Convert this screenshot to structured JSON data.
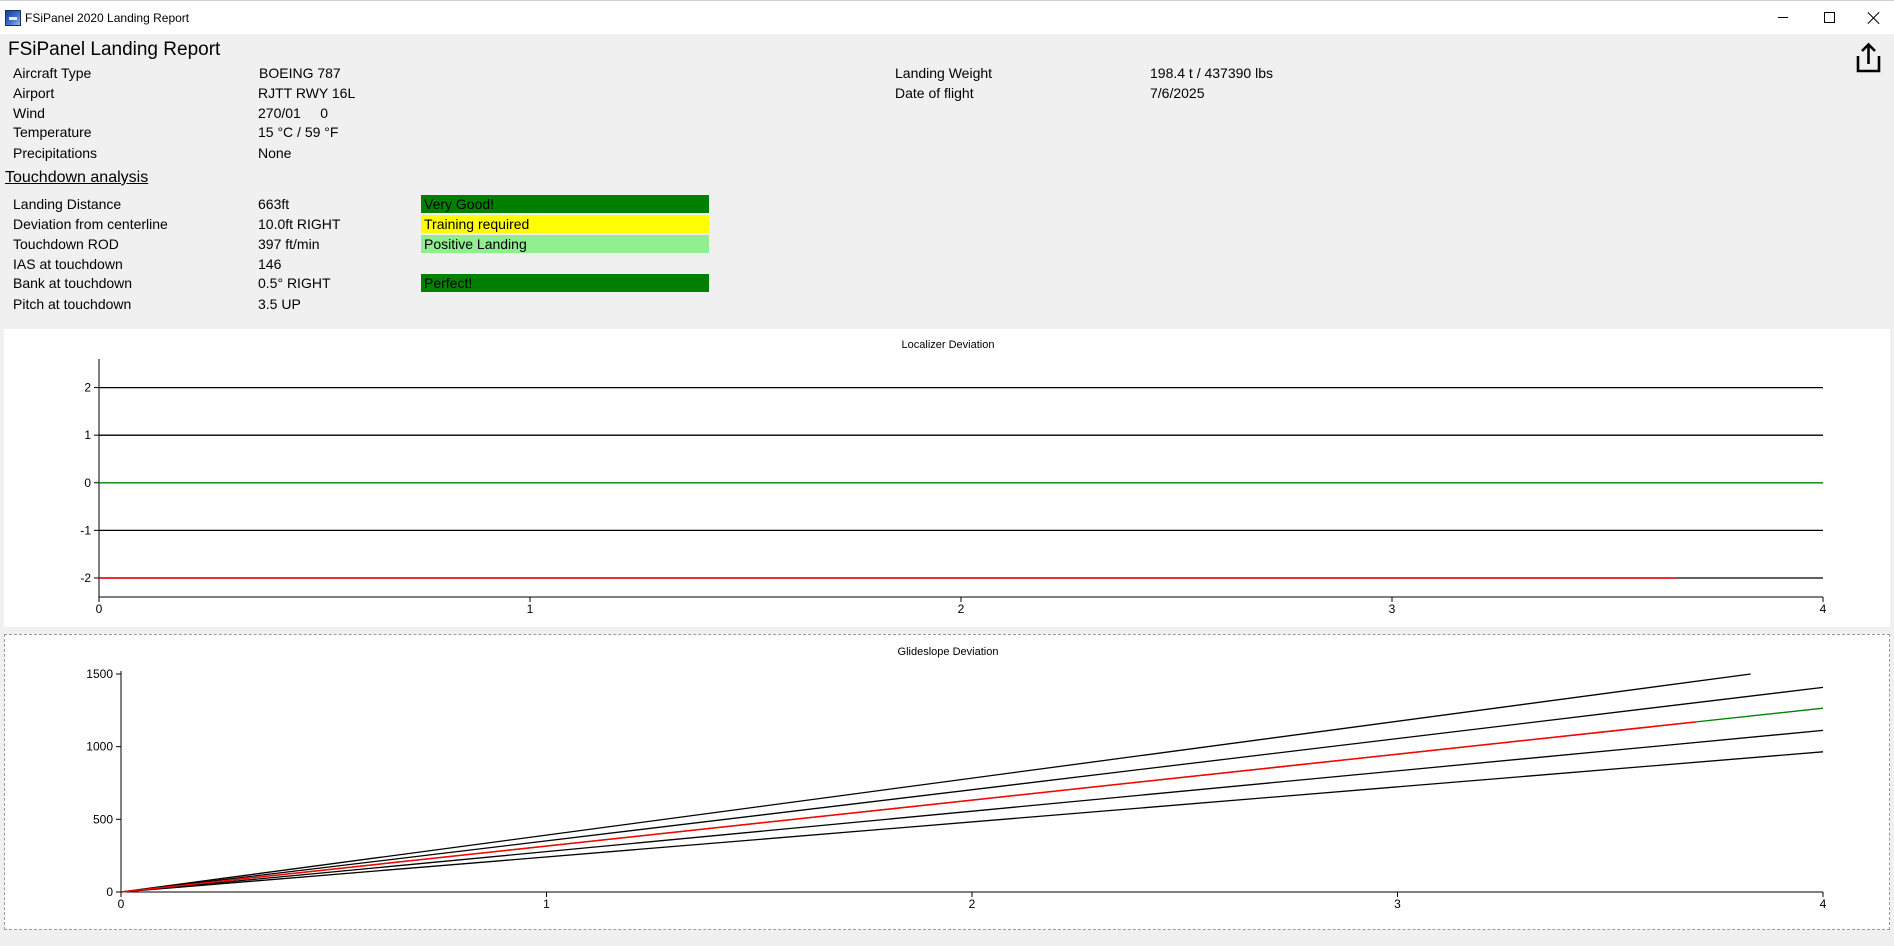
{
  "window": {
    "title": "FSiPanel 2020 Landing Report",
    "icon": "fsipanel-app-icon",
    "controls": [
      "minimize-icon",
      "maximize-icon",
      "close-icon"
    ]
  },
  "report": {
    "title": "FSiPanel Landing Report",
    "share_icon": "share-export-icon",
    "info": {
      "aircraft_type": {
        "label": "Aircraft Type",
        "value": "BOEING 787"
      },
      "airport": {
        "label": "Airport",
        "value": "RJTT RWY 16L"
      },
      "wind": {
        "label": "Wind",
        "value": "270/01     0"
      },
      "temperature": {
        "label": "Temperature",
        "value": "15 °C / 59 °F"
      },
      "precipitations": {
        "label": "Precipitations",
        "value": "None"
      },
      "landing_weight": {
        "label": "Landing Weight",
        "value": "198.4 t / 437390 lbs"
      },
      "date_of_flight": {
        "label": "Date of flight",
        "value": "7/6/2025"
      }
    },
    "touchdown": {
      "title": "Touchdown analysis",
      "rows": [
        {
          "label": "Landing Distance",
          "value": "663ft",
          "rating": "Very Good!",
          "rating_color": "#008000"
        },
        {
          "label": "Deviation from centerline",
          "value": "10.0ft RIGHT",
          "rating": "Training required",
          "rating_color": "#ffff00"
        },
        {
          "label": "Touchdown ROD",
          "value": "397 ft/min",
          "rating": "Positive Landing",
          "rating_color": "#90ee90"
        },
        {
          "label": "IAS at touchdown",
          "value": "146",
          "rating": "",
          "rating_color": ""
        },
        {
          "label": "Bank at touchdown",
          "value": "0.5° RIGHT",
          "rating": "Perfect!",
          "rating_color": "#008000"
        },
        {
          "label": "Pitch at touchdown",
          "value": "3.5 UP",
          "rating": "",
          "rating_color": ""
        }
      ]
    }
  },
  "chart_data": [
    {
      "type": "line",
      "title": "Localizer Deviation",
      "xlabel": "",
      "ylabel": "",
      "xlim": [
        0,
        4
      ],
      "ylim": [
        -2.4,
        2.6
      ],
      "x_ticks": [
        "0",
        "1",
        "2",
        "3",
        "4"
      ],
      "y_ticks": [
        "2",
        "1",
        "0",
        "-1",
        "-2"
      ],
      "series": [
        {
          "color": "#000000",
          "points": [
            [
              0,
              2
            ],
            [
              4,
              2
            ]
          ]
        },
        {
          "color": "#000000",
          "points": [
            [
              0,
              1
            ],
            [
              4,
              1
            ]
          ]
        },
        {
          "color": "#000000",
          "points": [
            [
              0,
              -1
            ],
            [
              4,
              -1
            ]
          ]
        },
        {
          "color": "#000000",
          "points": [
            [
              0,
              -2
            ],
            [
              4,
              -2
            ]
          ]
        },
        {
          "color": "#008000",
          "points": [
            [
              0,
              0
            ],
            [
              4,
              0
            ]
          ]
        },
        {
          "color": "#ff0000",
          "points": [
            [
              0,
              -2
            ],
            [
              3.66,
              -2
            ]
          ]
        }
      ]
    },
    {
      "type": "line",
      "title": "Glideslope Deviation",
      "xlabel": "",
      "ylabel": "",
      "xlim": [
        0,
        4
      ],
      "ylim": [
        0,
        1500
      ],
      "x_ticks": [
        "0",
        "1",
        "2",
        "3",
        "4"
      ],
      "y_ticks": [
        "1500",
        "1000",
        "500",
        "0"
      ],
      "series": [
        {
          "color": "#000000",
          "points": [
            [
              0,
              0
            ],
            [
              3.83,
              1500
            ]
          ]
        },
        {
          "color": "#000000",
          "points": [
            [
              0,
              0
            ],
            [
              4,
              1408
            ]
          ]
        },
        {
          "color": "#000000",
          "points": [
            [
              0,
              0
            ],
            [
              4,
              1112
            ]
          ]
        },
        {
          "color": "#000000",
          "points": [
            [
              0,
              0
            ],
            [
              4,
              965
            ]
          ]
        },
        {
          "color": "#008000",
          "points": [
            [
              0,
              0
            ],
            [
              4,
              1265
            ]
          ]
        },
        {
          "color": "#ff0000",
          "points": [
            [
              0,
              0
            ],
            [
              3.7,
              1170
            ]
          ]
        }
      ]
    }
  ]
}
